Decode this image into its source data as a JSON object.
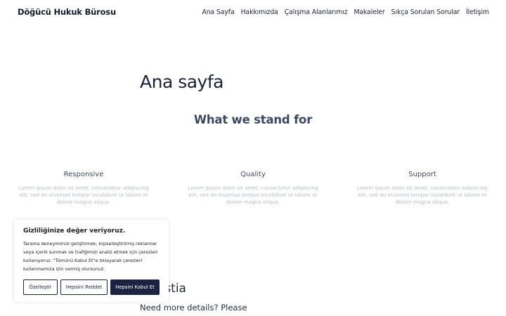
{
  "header": {
    "brand": "Döğücü Hukuk Bürosu",
    "nav": [
      {
        "label": "Ana Sayfa"
      },
      {
        "label": "Hakkımızda"
      },
      {
        "label": "Çalışma Alanlarımız"
      },
      {
        "label": "Makaleler"
      },
      {
        "label": "Sıkça Sorulan Sorular"
      },
      {
        "label": "İletişim"
      }
    ]
  },
  "hero": {
    "title": "Ana sayfa",
    "section_title": "What we stand for"
  },
  "features": [
    {
      "title": "Responsive",
      "text": "Lorem ipsum dolor sit amet, consectetur adipiscing elit, sed do eiusmod tempor incididunt ut labore et dolore magna aliqua."
    },
    {
      "title": "Quality",
      "text": "Lorem ipsum dolor sit amet, consectetur adipiscing elit, sed do eiusmod tempor incididunt ut labore et dolore magna aliqua."
    },
    {
      "title": "Support",
      "text": "Lorem ipsum dolor sit amet, consectetur adipiscing elit, sed do eiusmod tempor incididunt ut labore et dolore magna aliqua."
    }
  ],
  "about": {
    "title_visible": "t Hestia",
    "text": "Need more details? Please"
  },
  "cookie": {
    "title": "Gizliliğinize değer veriyoruz.",
    "text": "Tarama deneyiminizi geliştirmek, kişiselleştirilmiş reklamlar veya içerik sunmak ve trafiğimizi analiz etmek için çerezleri kullanıyoruz. \"Tümünü Kabul Et\"e tıklayarak çerezleri kullanmamıza izin vermiş olursunuz.",
    "customize_label": "Özelleştir",
    "reject_label": "Hepsini Reddet",
    "accept_label": "Hepsini Kabul Et",
    "accent_color": "#1c2340"
  }
}
